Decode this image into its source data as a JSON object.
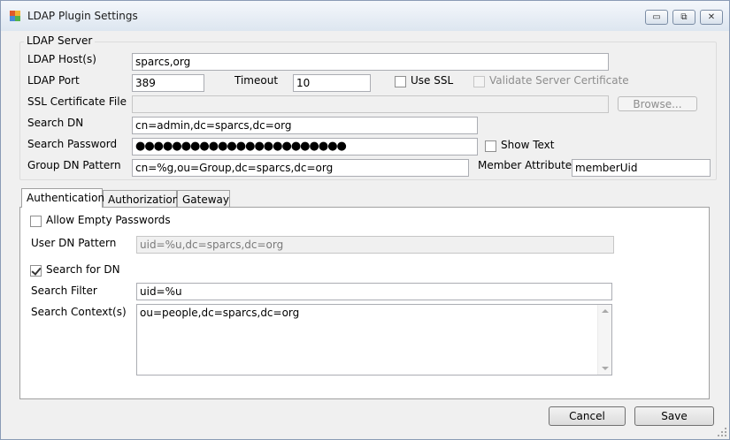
{
  "window": {
    "title": "LDAP Plugin Settings",
    "controls": {
      "minimize": "▭",
      "restore": "⧉",
      "close": "✕"
    }
  },
  "ldap_server": {
    "group_title": "LDAP Server",
    "host_label": "LDAP Host(s)",
    "host_value": "sparcs,org",
    "port_label": "LDAP Port",
    "port_value": "389",
    "timeout_label": "Timeout",
    "timeout_value": "10",
    "use_ssl_label": "Use SSL",
    "use_ssl_checked": false,
    "validate_cert_label": "Validate Server Certificate",
    "validate_cert_checked": false,
    "ssl_cert_label": "SSL Certificate File",
    "ssl_cert_value": "",
    "browse_label": "Browse...",
    "search_dn_label": "Search DN",
    "search_dn_value": "cn=admin,dc=sparcs,dc=org",
    "search_password_label": "Search Password",
    "search_password_value": "●●●●●●●●●●●●●●●●●●●●●●●",
    "show_text_label": "Show Text",
    "show_text_checked": false,
    "group_dn_label": "Group DN Pattern",
    "group_dn_value": "cn=%g,ou=Group,dc=sparcs,dc=org",
    "member_attr_label": "Member Attribute",
    "member_attr_value": "memberUid"
  },
  "tabs": [
    {
      "label": "Authentication",
      "active": true
    },
    {
      "label": "Authorization",
      "active": false
    },
    {
      "label": "Gateway",
      "active": false
    }
  ],
  "authentication": {
    "allow_empty_label": "Allow Empty Passwords",
    "allow_empty_checked": false,
    "user_dn_label": "User DN Pattern",
    "user_dn_value": "uid=%u,dc=sparcs,dc=org",
    "search_for_dn_label": "Search for DN",
    "search_for_dn_checked": true,
    "search_filter_label": "Search Filter",
    "search_filter_value": "uid=%u",
    "search_context_label": "Search Context(s)",
    "search_context_value": "ou=people,dc=sparcs,dc=org"
  },
  "footer": {
    "cancel_label": "Cancel",
    "save_label": "Save"
  },
  "icons": {
    "app": "app-icon",
    "minimize": "minimize-icon",
    "restore": "restore-icon",
    "close": "close-icon"
  }
}
